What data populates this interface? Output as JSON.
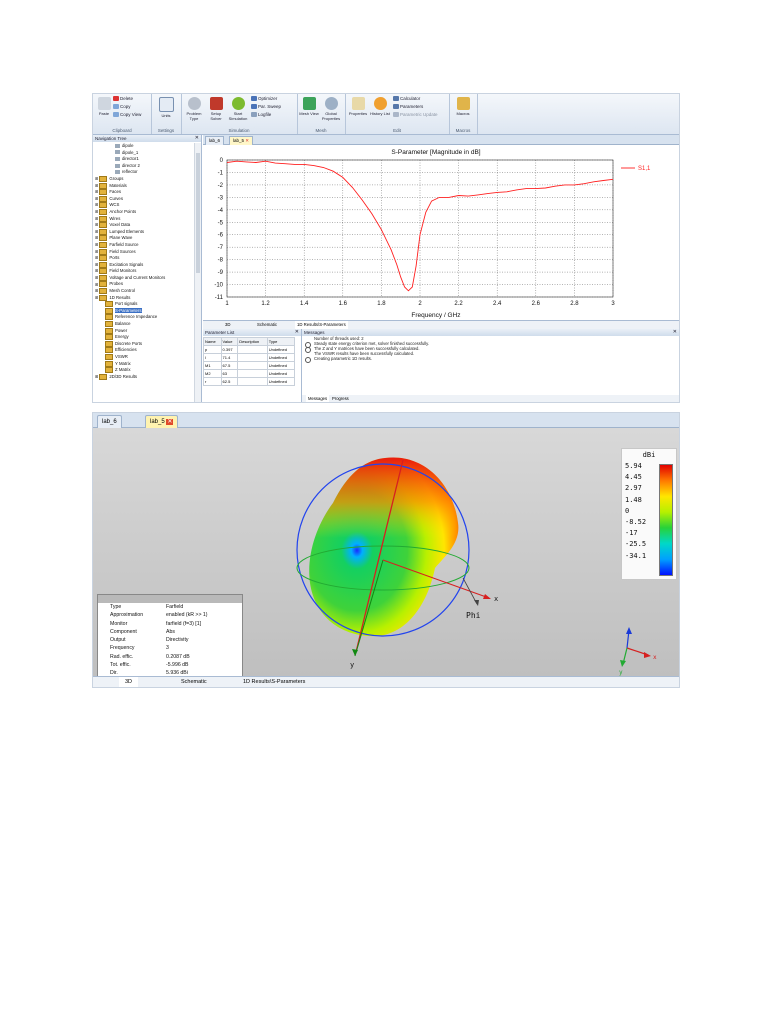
{
  "ribbon": {
    "clipboard": {
      "paste": "Paste",
      "delete": "Delete",
      "copy": "Copy",
      "copy_view": "Copy View",
      "label": "Clipboard"
    },
    "settings": {
      "units": "Units",
      "label": "Settings"
    },
    "simulation": {
      "problem_type": "Problem Type",
      "setup_solver": "Setup Solver",
      "start_simulation": "Start Simulation",
      "optimizer": "Optimizer",
      "par_sweep": "Par. Sweep",
      "logfile": "Logfile",
      "label": "Simulation"
    },
    "mesh": {
      "mesh_view": "Mesh View",
      "global_properties": "Global Properties",
      "label": "Mesh"
    },
    "edit": {
      "properties": "Properties",
      "history_list": "History List",
      "calculator": "Calculator",
      "parameters": "Parameters",
      "parametric_update": "Parametric Update",
      "label": "Edit"
    },
    "macros": {
      "macros": "Macros",
      "label": "Macros"
    }
  },
  "nav": {
    "title": "Navigation Tree",
    "items": [
      {
        "label": "dipole",
        "indent": 4,
        "kind": "item"
      },
      {
        "label": "dipole_1",
        "indent": 4,
        "kind": "item"
      },
      {
        "label": "director1",
        "indent": 4,
        "kind": "item"
      },
      {
        "label": "director 2",
        "indent": 4,
        "kind": "item"
      },
      {
        "label": "reflector",
        "indent": 4,
        "kind": "item"
      },
      {
        "label": "Groups",
        "indent": 0,
        "kind": "folder"
      },
      {
        "label": "Materials",
        "indent": 0,
        "kind": "folder"
      },
      {
        "label": "Faces",
        "indent": 0,
        "kind": "folder"
      },
      {
        "label": "Curves",
        "indent": 0,
        "kind": "folder"
      },
      {
        "label": "WCS",
        "indent": 0,
        "kind": "folder"
      },
      {
        "label": "Anchor Points",
        "indent": 0,
        "kind": "folder"
      },
      {
        "label": "Wires",
        "indent": 0,
        "kind": "folder"
      },
      {
        "label": "Voxel Data",
        "indent": 0,
        "kind": "folder"
      },
      {
        "label": "Lumped Elements",
        "indent": 0,
        "kind": "folder"
      },
      {
        "label": "Plane Wave",
        "indent": 0,
        "kind": "folder"
      },
      {
        "label": "Farfield Source",
        "indent": 0,
        "kind": "folder"
      },
      {
        "label": "Field Sources",
        "indent": 0,
        "kind": "folder"
      },
      {
        "label": "Ports",
        "indent": 0,
        "kind": "folder"
      },
      {
        "label": "Excitation Signals",
        "indent": 0,
        "kind": "folder"
      },
      {
        "label": "Field Monitors",
        "indent": 0,
        "kind": "folder"
      },
      {
        "label": "Voltage and Current Monitors",
        "indent": 0,
        "kind": "folder"
      },
      {
        "label": "Probes",
        "indent": 0,
        "kind": "folder"
      },
      {
        "label": "Mesh Control",
        "indent": 0,
        "kind": "folder"
      },
      {
        "label": "1D Results",
        "indent": 0,
        "kind": "folder"
      },
      {
        "label": "Port signals",
        "indent": 2,
        "kind": "folder"
      },
      {
        "label": "S-Parameters",
        "indent": 2,
        "kind": "folder",
        "selected": true
      },
      {
        "label": "Reference Impedance",
        "indent": 2,
        "kind": "folder"
      },
      {
        "label": "Balance",
        "indent": 2,
        "kind": "folder"
      },
      {
        "label": "Power",
        "indent": 2,
        "kind": "folder"
      },
      {
        "label": "Energy",
        "indent": 2,
        "kind": "folder"
      },
      {
        "label": "Discrete Ports",
        "indent": 2,
        "kind": "folder"
      },
      {
        "label": "Efficiencies",
        "indent": 2,
        "kind": "folder"
      },
      {
        "label": "VSWR",
        "indent": 2,
        "kind": "folder"
      },
      {
        "label": "Y Matrix",
        "indent": 2,
        "kind": "folder"
      },
      {
        "label": "Z Matrix",
        "indent": 2,
        "kind": "folder"
      },
      {
        "label": "2D/3D Results",
        "indent": 0,
        "kind": "folder"
      }
    ]
  },
  "doc_tabs": [
    "lab_6",
    "lab_5"
  ],
  "view_tabs": [
    "3D",
    "Schematic",
    "1D Results\\S-Parameters"
  ],
  "chart_data": {
    "type": "line",
    "title": "S-Parameter [Magnitude in dB]",
    "xlabel": "Frequency / GHz",
    "ylabel": "",
    "xlim": [
      1,
      3
    ],
    "ylim": [
      -11,
      0
    ],
    "xticks": [
      "1",
      "1.2",
      "1.4",
      "1.6",
      "1.8",
      "2",
      "2.2",
      "2.4",
      "2.6",
      "2.8",
      "3"
    ],
    "yticks": [
      "0",
      "-1",
      "-2",
      "-3",
      "-4",
      "-5",
      "-6",
      "-7",
      "-8",
      "-9",
      "-10",
      "-11"
    ],
    "grid": true,
    "legend": "top-right",
    "series": [
      {
        "name": "S1,1",
        "color": "#ff2020",
        "x": [
          1.0,
          1.05,
          1.1,
          1.15,
          1.2,
          1.25,
          1.3,
          1.35,
          1.4,
          1.45,
          1.5,
          1.55,
          1.6,
          1.65,
          1.7,
          1.75,
          1.8,
          1.85,
          1.88,
          1.9,
          1.92,
          1.94,
          1.96,
          1.98,
          2.0,
          2.03,
          2.06,
          2.1,
          2.15,
          2.2,
          2.25,
          2.3,
          2.35,
          2.4,
          2.45,
          2.5,
          2.55,
          2.6,
          2.65,
          2.7,
          2.75,
          2.8,
          2.85,
          2.9,
          2.95,
          3.0
        ],
        "y": [
          -0.2,
          -0.1,
          -0.15,
          -0.2,
          -0.1,
          -0.25,
          -0.3,
          -0.35,
          -0.35,
          -0.45,
          -0.6,
          -0.9,
          -1.4,
          -2.2,
          -3.2,
          -4.3,
          -5.6,
          -7.2,
          -8.4,
          -9.4,
          -10.2,
          -10.5,
          -10.2,
          -8.5,
          -6.0,
          -4.2,
          -3.3,
          -3.0,
          -3.0,
          -2.85,
          -2.9,
          -2.8,
          -2.7,
          -2.6,
          -2.55,
          -2.4,
          -2.3,
          -2.3,
          -2.25,
          -2.1,
          -2.0,
          -2.0,
          -1.9,
          -1.75,
          -1.65,
          -1.55
        ]
      }
    ]
  },
  "param_list": {
    "title": "Parameter List",
    "columns": [
      "Name",
      "Value",
      "Description",
      "Type"
    ],
    "rows": [
      [
        "p",
        "0.397",
        "",
        "Undefined"
      ],
      [
        "l",
        "71.4",
        "",
        "Undefined"
      ],
      [
        "M1",
        "67.5",
        "",
        "Undefined"
      ],
      [
        "M2",
        "63",
        "",
        "Undefined"
      ],
      [
        "r",
        "62.5",
        "",
        "Undefined"
      ]
    ]
  },
  "messages": {
    "title": "Messages",
    "lines": [
      {
        "text": "Number of threads used: 2",
        "icon": false
      },
      {
        "text": "Steady state energy criterion met, solver finished successfully.",
        "icon": true
      },
      {
        "text": "The Z and Y matrices have been successfully calculated.",
        "icon": true
      },
      {
        "text": "The VSWR results have been successfully calculated.",
        "icon": false
      },
      {
        "text": "Creating parametric 1D results.",
        "icon": true
      }
    ],
    "tabs": [
      "Messages",
      "Progress"
    ]
  },
  "farfield": {
    "tabs": [
      "lab_6",
      "lab_5"
    ],
    "info": [
      [
        "Type",
        "Farfield"
      ],
      [
        "Approximation",
        "enabled (kR >> 1)"
      ],
      [
        "Monitor",
        "farfield (f=3) [1]"
      ],
      [
        "Component",
        "Abs"
      ],
      [
        "Output",
        "Directivity"
      ],
      [
        "Frequency",
        "3"
      ],
      [
        "Rad. effic.",
        "0.2087 dB"
      ],
      [
        "Tot. effic.",
        "-5.996 dB"
      ],
      [
        "Dir.",
        "5.936 dBi"
      ]
    ],
    "legend_title": "dBi",
    "legend_values": [
      "5.94",
      "4.45",
      "2.97",
      "1.48",
      "0",
      "-8.52",
      "-17",
      "-25.5",
      "-34.1"
    ],
    "axis_x": "x",
    "axis_y": "y",
    "axis_z": "z",
    "phi": "Phi",
    "view_tabs": [
      "3D",
      "Schematic",
      "1D Results\\S-Parameters"
    ]
  }
}
